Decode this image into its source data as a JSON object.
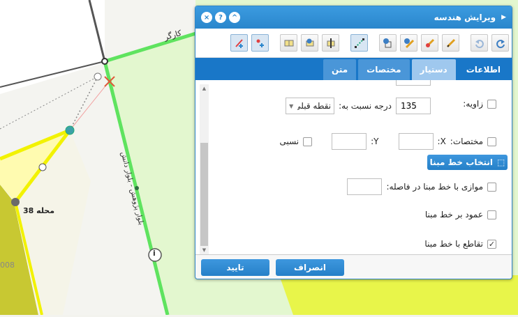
{
  "map": {
    "street_label_top": "کارگر",
    "street_label_side": "بلوار پژوهش - بلوار دانش",
    "district_label": "محله 38",
    "parcel_number": "008"
  },
  "dialog": {
    "title": "ویرایش هندسه",
    "controls": {
      "close": "×",
      "help": "?",
      "collapse": "^"
    },
    "tools": [
      {
        "icon": "redo-icon"
      },
      {
        "icon": "undo-icon"
      },
      {
        "icon": "pencil-icon"
      },
      {
        "icon": "add-vertex-icon"
      },
      {
        "icon": "edit-info-icon"
      },
      {
        "icon": "vertex-settings-icon"
      },
      {
        "icon": "snap-line-icon"
      },
      {
        "icon": "split-icon"
      },
      {
        "icon": "info-marker-icon"
      },
      {
        "icon": "table-icon"
      },
      {
        "icon": "add-point-icon"
      },
      {
        "icon": "add-line-icon"
      }
    ],
    "tabs": [
      {
        "label": "اطلاعات",
        "state": "inactive"
      },
      {
        "label": "دستیار",
        "state": "active"
      },
      {
        "label": "مختصات",
        "state": "inactive"
      },
      {
        "label": "متن",
        "state": "inactive"
      }
    ],
    "form": {
      "angle_label": "زاویه:",
      "angle_value": "135",
      "angle_unit": "درجه نسبت به:",
      "reference_value": "نقطه قبلی",
      "coords_label": "مختصات:",
      "x_label": "X:",
      "y_label": "Y:",
      "x_value": "",
      "y_value": "",
      "relative_label": "نسبی",
      "pick_line_label": "انتخاب خط مبنا",
      "parallel_label": "موازی با خط مبنا در فاصله:",
      "parallel_value": "",
      "perpendicular_label": "عمود بر خط مبنا",
      "intersection_label": "تقاطع با خط مبنا",
      "angle_checked": false,
      "coords_checked": false,
      "relative_checked": false,
      "parallel_checked": false,
      "perpendicular_checked": false,
      "intersection_checked": true
    },
    "footer": {
      "confirm_label": "تایید",
      "cancel_label": "انصراف"
    }
  }
}
